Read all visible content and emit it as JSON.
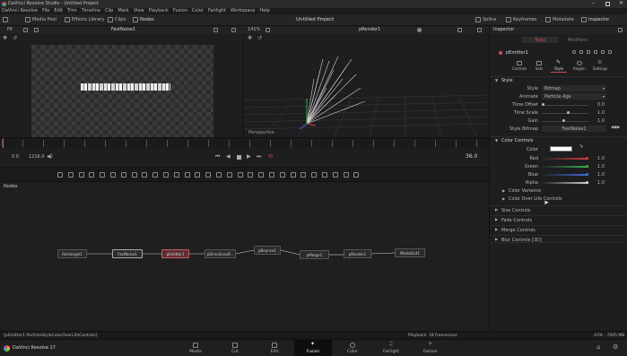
{
  "titlebar": {
    "app_title": "DaVinci Resolve Studio - Untitled Project"
  },
  "menubar": [
    "DaVinci Resolve",
    "File",
    "Edit",
    "Trim",
    "Timeline",
    "Clip",
    "Mark",
    "View",
    "Playback",
    "Fusion",
    "Color",
    "Fairlight",
    "Workspace",
    "Help"
  ],
  "toolbar": {
    "media_pool": "Media Pool",
    "effects_library": "Effects Library",
    "clips": "Clips",
    "nodes": "Nodes",
    "project_title": "Untitled Project",
    "spline": "Spline",
    "keyframes": "Keyframes",
    "metadata": "Metadata",
    "inspector": "Inspector"
  },
  "viewer_left": {
    "fit": "Fit",
    "node_name": "FastNoise1"
  },
  "viewer_right": {
    "zoom": "141%",
    "node_name": "pRender1",
    "perspective_label": "Perspective"
  },
  "playback": {
    "current_time": "0.0",
    "end_time": "1216.0",
    "frame": "36.0"
  },
  "nodes_panel": {
    "title": "Nodes",
    "nodes": [
      "Rectangle1",
      "FastNoise1",
      "pEmitter1",
      "pDirectionalF...",
      "pBounce1",
      "pMerge1",
      "pRender1",
      "MediaOut1"
    ]
  },
  "inspector": {
    "title": "Inspector",
    "tab_tools": "Tools",
    "tab_modifiers": "Modifiers",
    "node_name": "pEmitter1",
    "sub_tabs": [
      "Controls",
      "Sets",
      "Style",
      "Region",
      "Settings"
    ],
    "style_section": "Style",
    "style_rows": [
      {
        "label": "Style",
        "value": "Bitmap"
      },
      {
        "label": "Animate",
        "value": "Particle Age"
      },
      {
        "label": "Time Offset",
        "value": "0.0"
      },
      {
        "label": "Time Scale",
        "value": "1.0"
      },
      {
        "label": "Gain",
        "value": "1.0"
      },
      {
        "label": "Style Bitmap",
        "value": "FastNoise1"
      }
    ],
    "color_controls_section": "Color Controls",
    "color_label": "Color",
    "color_rows": [
      {
        "label": "Red",
        "value": "1.0",
        "color": "#d23a3a"
      },
      {
        "label": "Green",
        "value": "1.0",
        "color": "#3ab34a"
      },
      {
        "label": "Blue",
        "value": "1.0",
        "color": "#3a6fd2"
      },
      {
        "label": "Alpha",
        "value": "1.0",
        "color": "#cfcfcf"
      }
    ],
    "color_variance": "Color Variance",
    "color_over_life": "Color Over Life Controls",
    "collapsed_sections": [
      "Size Controls",
      "Fade Controls",
      "Merge Controls",
      "Blur Controls [3D]"
    ]
  },
  "status": {
    "path": "[pEmitter1.ParticleStyleColorOverLifeControls]",
    "playback": "Playback: 18 frames/sec",
    "zoom": "43% - 7005 MB"
  },
  "pages": [
    {
      "label": "Media",
      "active": false
    },
    {
      "label": "Cut",
      "active": false
    },
    {
      "label": "Edit",
      "active": false
    },
    {
      "label": "Fusion",
      "active": true
    },
    {
      "label": "Color",
      "active": false
    },
    {
      "label": "Fairlight",
      "active": false
    },
    {
      "label": "Deliver",
      "active": false
    }
  ],
  "app_name": "DaVinci Resolve 17",
  "colors": {
    "accent_red": "#d84a4a",
    "active_page_bg": "#0e0e10",
    "panel_bg": "#1e1e21",
    "node_selected": "#5a2f33"
  }
}
